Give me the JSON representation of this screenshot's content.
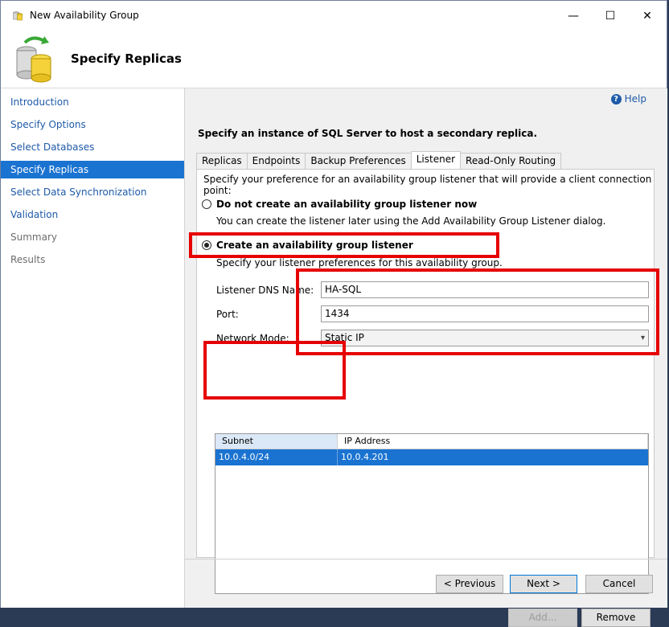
{
  "window": {
    "title": "New Availability Group",
    "minimize_label": "—",
    "maximize_label": "☐",
    "close_label": "✕"
  },
  "header": {
    "title": "Specify Replicas"
  },
  "nav": {
    "items": [
      {
        "label": "Introduction"
      },
      {
        "label": "Specify Options"
      },
      {
        "label": "Select Databases"
      },
      {
        "label": "Specify Replicas"
      },
      {
        "label": "Select Data Synchronization"
      },
      {
        "label": "Validation"
      },
      {
        "label": "Summary"
      },
      {
        "label": "Results"
      }
    ]
  },
  "help": {
    "label": "Help",
    "icon_glyph": "?"
  },
  "main": {
    "instruction": "Specify an instance of SQL Server to host a secondary replica.",
    "tabs": [
      {
        "label": "Replicas"
      },
      {
        "label": "Endpoints"
      },
      {
        "label": "Backup Preferences"
      },
      {
        "label": "Listener"
      },
      {
        "label": "Read-Only Routing"
      }
    ],
    "listener": {
      "description": "Specify your preference for an availability group listener that will provide a client connection point:",
      "option_none": {
        "label": "Do not create an availability group listener now",
        "sub": "You can create the listener later using the Add Availability Group Listener dialog."
      },
      "option_create": {
        "label": "Create an availability group listener",
        "sub": "Specify your listener preferences for this availability group."
      },
      "dns_label": "Listener DNS Name:",
      "dns_value": "HA-SQL",
      "port_label": "Port:",
      "port_value": "1434",
      "mode_label": "Network Mode:",
      "mode_value": "Static IP",
      "grid": {
        "columns": [
          "Subnet",
          "IP Address"
        ],
        "rows": [
          {
            "subnet": "10.0.4.0/24",
            "ip": "10.0.4.201"
          }
        ]
      },
      "add_label": "Add...",
      "remove_label": "Remove"
    }
  },
  "footer": {
    "previous_label": "< Previous",
    "next_label": "Next >",
    "cancel_label": "Cancel"
  },
  "colors": {
    "accent": "#1a73d1",
    "highlight": "#e60000",
    "link": "#1e5aa8"
  }
}
